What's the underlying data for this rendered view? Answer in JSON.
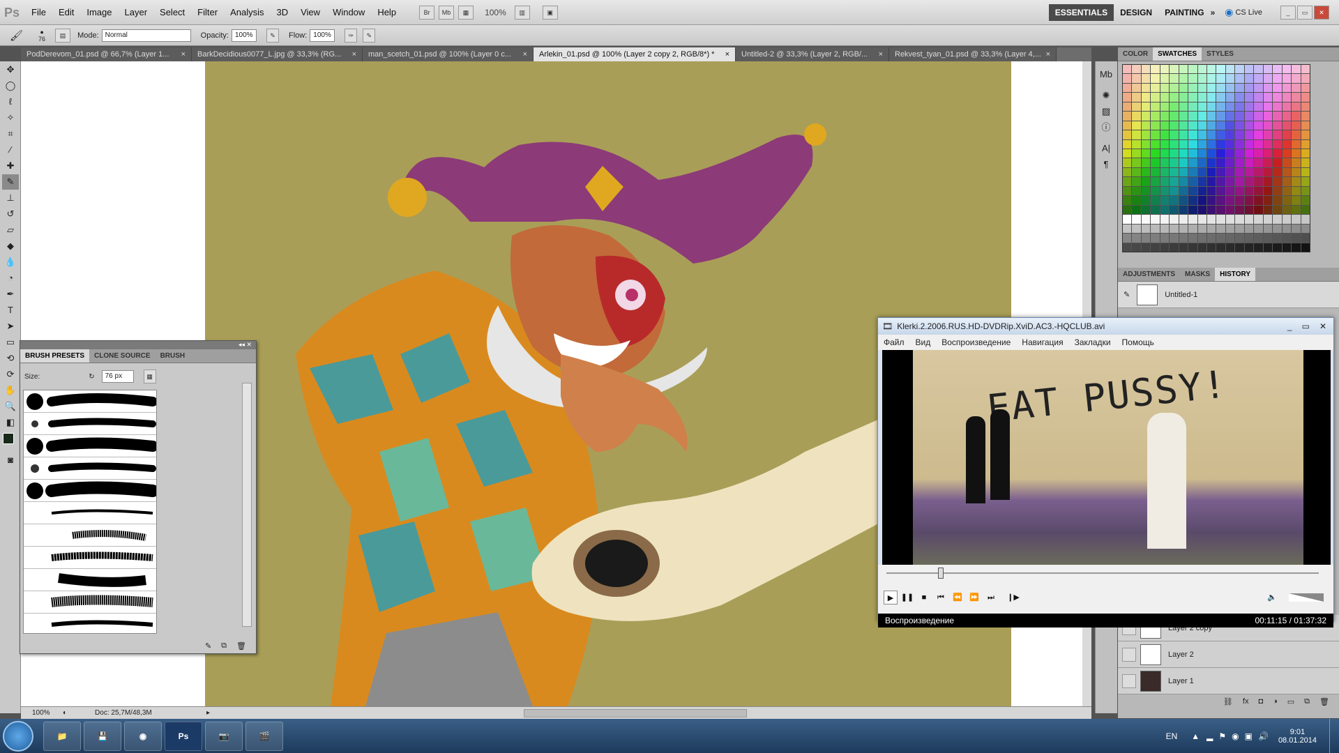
{
  "menubar": {
    "logo": "Ps",
    "items": [
      "File",
      "Edit",
      "Image",
      "Layer",
      "Select",
      "Filter",
      "Analysis",
      "3D",
      "View",
      "Window",
      "Help"
    ],
    "bridge_btn": "Br",
    "minibridge_btn": "Mb",
    "zoom": "100%",
    "workspaces": [
      "ESSENTIALS",
      "DESIGN",
      "PAINTING"
    ],
    "cs_live": "CS Live"
  },
  "options": {
    "brush_size": "76",
    "mode_label": "Mode:",
    "mode_value": "Normal",
    "opacity_label": "Opacity:",
    "opacity_value": "100%",
    "flow_label": "Flow:",
    "flow_value": "100%"
  },
  "tabs": [
    {
      "label": "PodDerevom_01.psd @ 66,7% (Layer 1..."
    },
    {
      "label": "BarkDecidious0077_L.jpg @ 33,3% (RG..."
    },
    {
      "label": "man_scetch_01.psd @ 100% (Layer 0 c..."
    },
    {
      "label": "Arlekin_01.psd @ 100% (Layer 2 copy 2, RGB/8*) *"
    },
    {
      "label": "Untitled-2 @ 33,3% (Layer 2, RGB/..."
    },
    {
      "label": "Rekvest_tyan_01.psd @ 33,3% (Layer 4,..."
    }
  ],
  "status": {
    "zoom": "100%",
    "doc": "Doc: 25,7M/48,3M"
  },
  "swatch_panel": {
    "tabs": [
      "COLOR",
      "SWATCHES",
      "STYLES"
    ]
  },
  "history_panel": {
    "tabs": [
      "ADJUSTMENTS",
      "MASKS",
      "HISTORY"
    ],
    "snapshot": "Untitled-1"
  },
  "layers": [
    {
      "name": "Layer 2 copy"
    },
    {
      "name": "Layer 2"
    },
    {
      "name": "Layer 1"
    }
  ],
  "brush_panel": {
    "tabs": [
      "BRUSH PRESETS",
      "CLONE SOURCE",
      "BRUSH"
    ],
    "size_label": "Size:",
    "size_value": "76 px"
  },
  "player": {
    "title": "Klerki.2.2006.RUS.HD-DVDRip.XviD.AC3.-HQCLUB.avi",
    "menu": [
      "Файл",
      "Вид",
      "Воспроизведение",
      "Навигация",
      "Закладки",
      "Помощь"
    ],
    "video_text": "EAT PUSSY!",
    "progress": 0.12,
    "status_label": "Воспроизведение",
    "time": "00:11:15 / 01:37:32"
  },
  "taskbar": {
    "lang": "EN",
    "time": "9:01",
    "date": "08.01.2014",
    "ps_label": "Ps"
  }
}
